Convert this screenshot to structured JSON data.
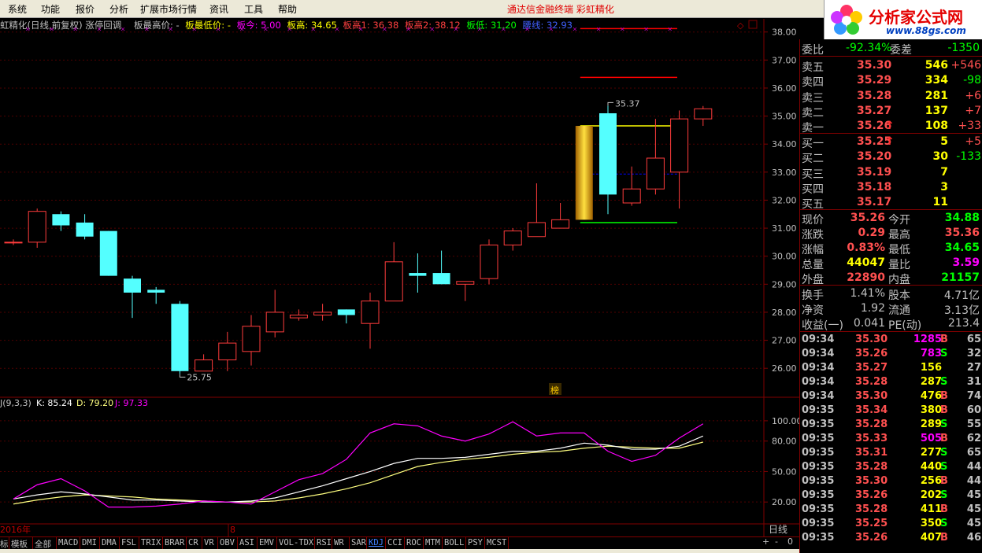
{
  "menu": [
    "系统",
    "功能",
    "报价",
    "分析",
    "扩展市场行情",
    "资讯",
    "工具",
    "帮助"
  ],
  "title_center": "通达信金融终端   彩虹精化",
  "logo": {
    "text": "分析家公式网",
    "url": "www.88gs.com"
  },
  "chart_header": {
    "name": "虹精化(日线,前复权) 涨停回调",
    "bzg": "板最高价: -",
    "bzd": "板最低价: -",
    "bj": "板今: 5.00",
    "bg": "板高: 34.65",
    "bg1": "板高1: 36.38",
    "bg2": "板高2: 38.12",
    "bd": "板低: 31.20",
    "zx": "腰线: 32.93"
  },
  "kdj_header": {
    "name": "J(9,3,3)",
    "k": "K: 85.24",
    "d": "D: 79.20",
    "j": "J: 97.33"
  },
  "bottom_labels": {
    "year": "2016年",
    "month": "8",
    "period": "日线",
    "badge": "榜"
  },
  "annotations": {
    "high": "35.37",
    "low": "25.75"
  },
  "price_axis": [
    "38.00",
    "37.00",
    "36.00",
    "35.00",
    "34.00",
    "33.00",
    "32.00",
    "31.00",
    "30.00",
    "29.00",
    "28.00",
    "27.00",
    "26.00"
  ],
  "kdj_axis": [
    "100.00",
    "80.00",
    "50.00",
    "20.00"
  ],
  "chart_data": {
    "type": "candlestick",
    "ylim": [
      25.5,
      38.3
    ],
    "candles": [
      {
        "o": 30.5,
        "c": 30.5,
        "h": 30.6,
        "l": 30.4
      },
      {
        "o": 30.5,
        "c": 31.6,
        "h": 31.7,
        "l": 30.3
      },
      {
        "o": 31.5,
        "c": 31.1,
        "h": 31.6,
        "l": 30.9
      },
      {
        "o": 31.2,
        "c": 30.7,
        "h": 31.5,
        "l": 30.6
      },
      {
        "o": 30.9,
        "c": 29.3,
        "h": 30.9,
        "l": 29.3
      },
      {
        "o": 29.2,
        "c": 28.7,
        "h": 29.3,
        "l": 27.8
      },
      {
        "o": 28.8,
        "c": 28.7,
        "h": 28.9,
        "l": 28.3
      },
      {
        "o": 28.3,
        "c": 25.9,
        "h": 28.4,
        "l": 25.8
      },
      {
        "o": 25.9,
        "c": 26.3,
        "h": 26.5,
        "l": 25.9
      },
      {
        "o": 26.3,
        "c": 26.9,
        "h": 27.3,
        "l": 25.9
      },
      {
        "o": 26.6,
        "c": 27.5,
        "h": 27.9,
        "l": 26.1
      },
      {
        "o": 27.3,
        "c": 28.0,
        "h": 28.8,
        "l": 27.1
      },
      {
        "o": 27.8,
        "c": 27.9,
        "h": 28.1,
        "l": 27.7
      },
      {
        "o": 27.9,
        "c": 28.0,
        "h": 28.3,
        "l": 27.7
      },
      {
        "o": 28.1,
        "c": 27.9,
        "h": 28.1,
        "l": 27.6
      },
      {
        "o": 27.6,
        "c": 28.4,
        "h": 28.7,
        "l": 26.7
      },
      {
        "o": 28.4,
        "c": 29.8,
        "h": 30.5,
        "l": 28.4
      },
      {
        "o": 29.4,
        "c": 29.3,
        "h": 30.1,
        "l": 28.7
      },
      {
        "o": 29.4,
        "c": 29.0,
        "h": 30.2,
        "l": 29.0
      },
      {
        "o": 29.0,
        "c": 29.1,
        "h": 29.1,
        "l": 28.4
      },
      {
        "o": 29.2,
        "c": 30.4,
        "h": 30.6,
        "l": 29.0
      },
      {
        "o": 30.4,
        "c": 30.9,
        "h": 31.0,
        "l": 30.2
      },
      {
        "o": 30.7,
        "c": 31.2,
        "h": 32.6,
        "l": 30.7
      },
      {
        "o": 31.0,
        "c": 31.3,
        "h": 31.9,
        "l": 31.0
      },
      {
        "o": 31.3,
        "c": 34.65,
        "h": 34.65,
        "l": 31.2
      },
      {
        "o": 35.1,
        "c": 32.2,
        "h": 35.37,
        "l": 31.5
      },
      {
        "o": 31.9,
        "c": 32.4,
        "h": 33.2,
        "l": 31.8
      },
      {
        "o": 32.4,
        "c": 33.5,
        "h": 34.9,
        "l": 32.2
      },
      {
        "o": 33.0,
        "c": 34.9,
        "h": 35.2,
        "l": 31.7
      },
      {
        "o": 34.9,
        "c": 35.26,
        "h": 35.36,
        "l": 34.65
      }
    ],
    "limit_up_index": 24,
    "levels": [
      {
        "name": "板高2",
        "value": 38.12,
        "color": "#ff0000"
      },
      {
        "name": "板高1",
        "value": 36.38,
        "color": "#ff0000"
      },
      {
        "name": "板高",
        "value": 34.65,
        "color": "#ffff00"
      },
      {
        "name": "腰线",
        "value": 32.93,
        "color": "#0000ff"
      },
      {
        "name": "板低",
        "value": 31.2,
        "color": "#00ff00"
      }
    ],
    "kdj": {
      "ylim": [
        0,
        110
      ],
      "k": [
        23,
        27,
        30,
        28,
        25,
        22,
        22,
        21,
        20,
        20,
        21,
        24,
        30,
        36,
        43,
        50,
        58,
        63,
        63,
        64,
        67,
        70,
        70,
        73,
        78,
        76,
        72,
        72,
        75,
        85
      ],
      "d": [
        18,
        22,
        25,
        27,
        26,
        25,
        23,
        22,
        21,
        20,
        20,
        21,
        24,
        28,
        33,
        39,
        47,
        55,
        59,
        62,
        64,
        67,
        69,
        70,
        73,
        75,
        74,
        73,
        73,
        79
      ],
      "j": [
        23,
        37,
        43,
        31,
        15,
        15,
        16,
        18,
        21,
        20,
        18,
        30,
        42,
        48,
        62,
        88,
        97,
        95,
        85,
        80,
        87,
        99,
        85,
        88,
        88,
        70,
        60,
        66,
        83,
        97
      ]
    }
  },
  "quote": {
    "wb": {
      "label": "委比",
      "value": "-92.34%",
      "label2": "委差",
      "value2": "-1350"
    },
    "asks": [
      {
        "label": "卖五",
        "price": "35.30",
        "vol": "546",
        "chg": "+546"
      },
      {
        "label": "卖四",
        "price": "35.29",
        "vol": "334",
        "chg": "-98"
      },
      {
        "label": "卖三",
        "price": "35.28",
        "vol": "281",
        "chg": "+6"
      },
      {
        "label": "卖二",
        "price": "35.27",
        "vol": "137",
        "chg": "+7"
      },
      {
        "label": "卖一",
        "price": "35.26",
        "vol": "108",
        "chg": "+33",
        "arrow": "↑"
      }
    ],
    "bids": [
      {
        "label": "买一",
        "price": "35.25",
        "vol": "5",
        "chg": "+5",
        "arrow": "↑"
      },
      {
        "label": "买二",
        "price": "35.20",
        "vol": "30",
        "chg": "-133"
      },
      {
        "label": "买三",
        "price": "35.19",
        "vol": "7",
        "chg": ""
      },
      {
        "label": "买四",
        "price": "35.18",
        "vol": "3",
        "chg": ""
      },
      {
        "label": "买五",
        "price": "35.17",
        "vol": "11",
        "chg": ""
      }
    ],
    "stats": [
      {
        "l1": "现价",
        "v1": "35.26",
        "c1": "#ff5050",
        "l2": "今开",
        "v2": "34.88",
        "c2": "#00ff00"
      },
      {
        "l1": "涨跌",
        "v1": "0.29",
        "c1": "#ff5050",
        "l2": "最高",
        "v2": "35.36",
        "c2": "#ff5050"
      },
      {
        "l1": "涨幅",
        "v1": "0.83%",
        "c1": "#ff5050",
        "l2": "最低",
        "v2": "34.65",
        "c2": "#00ff00"
      },
      {
        "l1": "总量",
        "v1": "44047",
        "c1": "#ffff00",
        "l2": "量比",
        "v2": "3.59",
        "c2": "#ff00ff"
      },
      {
        "l1": "外盘",
        "v1": "22890",
        "c1": "#ff5050",
        "l2": "内盘",
        "v2": "21157",
        "c2": "#00ff00"
      }
    ],
    "stats2": [
      {
        "l1": "换手",
        "v1": "1.41%",
        "l2": "股本",
        "v2": "4.71亿"
      },
      {
        "l1": "净资",
        "v1": "1.92",
        "l2": "流通",
        "v2": "3.13亿"
      },
      {
        "l1": "收益(一)",
        "v1": "0.041",
        "l2": "PE(动)",
        "v2": "213.4"
      }
    ],
    "ticks": [
      {
        "t": "09:34",
        "p": "35.30",
        "v": "1285",
        "s": "B",
        "n": "65",
        "pc": "#ff5050",
        "vc": "#ff00ff"
      },
      {
        "t": "09:34",
        "p": "35.26",
        "v": "783",
        "s": "S",
        "n": "32",
        "pc": "#ff5050",
        "vc": "#ff00ff"
      },
      {
        "t": "09:34",
        "p": "35.27",
        "v": "156",
        "s": "",
        "n": "27",
        "pc": "#ff5050",
        "vc": "#ffff00"
      },
      {
        "t": "09:34",
        "p": "35.28",
        "v": "287",
        "s": "S",
        "n": "31",
        "pc": "#ff5050",
        "vc": "#ffff00"
      },
      {
        "t": "09:34",
        "p": "35.30",
        "v": "476",
        "s": "B",
        "n": "74",
        "pc": "#ff5050",
        "vc": "#ffff00"
      },
      {
        "t": "09:35",
        "p": "35.34",
        "v": "380",
        "s": "B",
        "n": "60",
        "pc": "#ff5050",
        "vc": "#ffff00"
      },
      {
        "t": "09:35",
        "p": "35.28",
        "v": "289",
        "s": "S",
        "n": "55",
        "pc": "#ff5050",
        "vc": "#ffff00"
      },
      {
        "t": "09:35",
        "p": "35.33",
        "v": "505",
        "s": "B",
        "n": "62",
        "pc": "#ff5050",
        "vc": "#ff00ff"
      },
      {
        "t": "09:35",
        "p": "35.31",
        "v": "277",
        "s": "S",
        "n": "65",
        "pc": "#ff5050",
        "vc": "#ffff00"
      },
      {
        "t": "09:35",
        "p": "35.28",
        "v": "440",
        "s": "S",
        "n": "44",
        "pc": "#ff5050",
        "vc": "#ffff00"
      },
      {
        "t": "09:35",
        "p": "35.30",
        "v": "256",
        "s": "B",
        "n": "44",
        "pc": "#ff5050",
        "vc": "#ffff00"
      },
      {
        "t": "09:35",
        "p": "35.26",
        "v": "202",
        "s": "S",
        "n": "45",
        "pc": "#ff5050",
        "vc": "#ffff00"
      },
      {
        "t": "09:35",
        "p": "35.28",
        "v": "411",
        "s": "B",
        "n": "45",
        "pc": "#ff5050",
        "vc": "#ffff00"
      },
      {
        "t": "09:35",
        "p": "35.25",
        "v": "350",
        "s": "S",
        "n": "45",
        "pc": "#ff5050",
        "vc": "#ffff00"
      },
      {
        "t": "09:35",
        "p": "35.26",
        "v": "407",
        "s": "B",
        "n": "46",
        "pc": "#ff5050",
        "vc": "#ffff00"
      }
    ]
  },
  "tabs": [
    "标",
    "模板",
    "全部",
    "MACD",
    "DMI",
    "DMA",
    "FSL",
    "TRIX",
    "BRAR",
    "CR",
    "VR",
    "OBV",
    "ASI",
    "EMV",
    "VOL-TDX",
    "RSI",
    "WR",
    "SAR",
    "KDJ",
    "CCI",
    "ROC",
    "MTM",
    "BOLL",
    "PSY",
    "MCST"
  ],
  "zoom": [
    "+",
    "-",
    "0"
  ]
}
